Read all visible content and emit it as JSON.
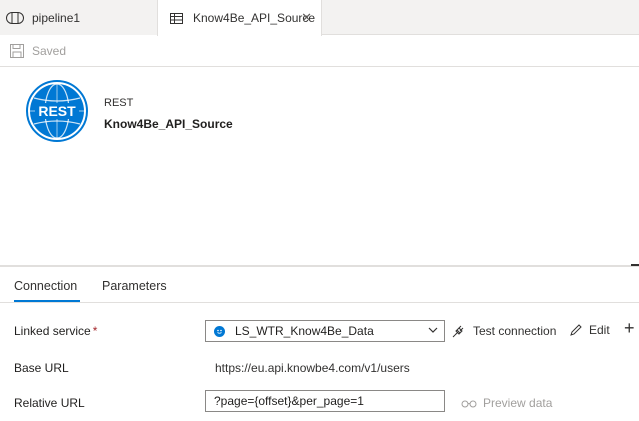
{
  "tabs": [
    {
      "label": "pipeline1",
      "icon": "pipeline-icon"
    },
    {
      "label": "Know4Be_API_Source",
      "icon": "dataset-table-icon",
      "active": true
    }
  ],
  "toolbar": {
    "saved_label": "Saved"
  },
  "dataset": {
    "logo_text": "REST",
    "type": "REST",
    "name": "Know4Be_API_Source"
  },
  "panel_tabs": [
    {
      "label": "Connection",
      "active": true
    },
    {
      "label": "Parameters"
    }
  ],
  "form": {
    "linked_service_label": "Linked service",
    "linked_service_required": "*",
    "linked_service_value": "LS_WTR_Know4Be_Data",
    "test_connection_label": "Test connection",
    "edit_label": "Edit",
    "new_label": "+",
    "base_url_label": "Base URL",
    "base_url_value": "https://eu.api.knowbe4.com/v1/users",
    "relative_url_label": "Relative URL",
    "relative_url_value": "?page={offset}&per_page=1",
    "preview_label": "Preview data"
  },
  "colors": {
    "accent": "#0078d4",
    "required": "#a4262c",
    "disabled": "#a19f9d"
  }
}
